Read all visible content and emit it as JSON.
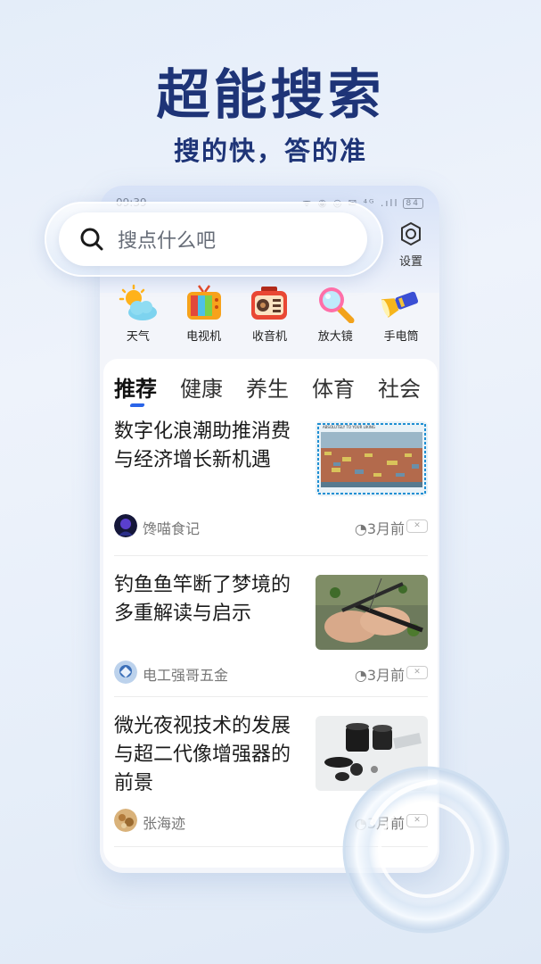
{
  "hero": {
    "title": "超能搜索",
    "subtitle": "搜的快，答的准"
  },
  "status_bar": {
    "time": "09:39",
    "icons": "ᯤ ◉ ◎ ✉ ⁴ᴳ .ıll",
    "battery": "84"
  },
  "search": {
    "placeholder": "搜点什么吧",
    "icon": "search-icon"
  },
  "settings": {
    "label": "设置",
    "icon": "gear-icon"
  },
  "tools": [
    {
      "label": "天气",
      "icon": "weather-icon"
    },
    {
      "label": "电视机",
      "icon": "tv-icon"
    },
    {
      "label": "收音机",
      "icon": "radio-icon"
    },
    {
      "label": "放大镜",
      "icon": "magnifier-icon"
    },
    {
      "label": "手电筒",
      "icon": "flashlight-icon"
    }
  ],
  "tabs": [
    {
      "label": "推荐",
      "active": true
    },
    {
      "label": "健康"
    },
    {
      "label": "养生"
    },
    {
      "label": "体育"
    },
    {
      "label": "社会"
    }
  ],
  "articles": [
    {
      "title": "数字化浪潮助推消费与经济增长新机遇",
      "author": "馋喵食记",
      "time": "3月前",
      "thumb_caption": "ABSOLUTELY TO YOUR LIKING"
    },
    {
      "title": "钓鱼鱼竿断了梦境的多重解读与启示",
      "author": "电工强哥五金",
      "time": "3月前"
    },
    {
      "title": "微光夜视技术的发展与超二代像增强器的前景",
      "author": "张海迹",
      "time": "3月前"
    }
  ],
  "colors": {
    "hero_text": "#1e3477",
    "tab_indicator": "#2a64e8"
  }
}
